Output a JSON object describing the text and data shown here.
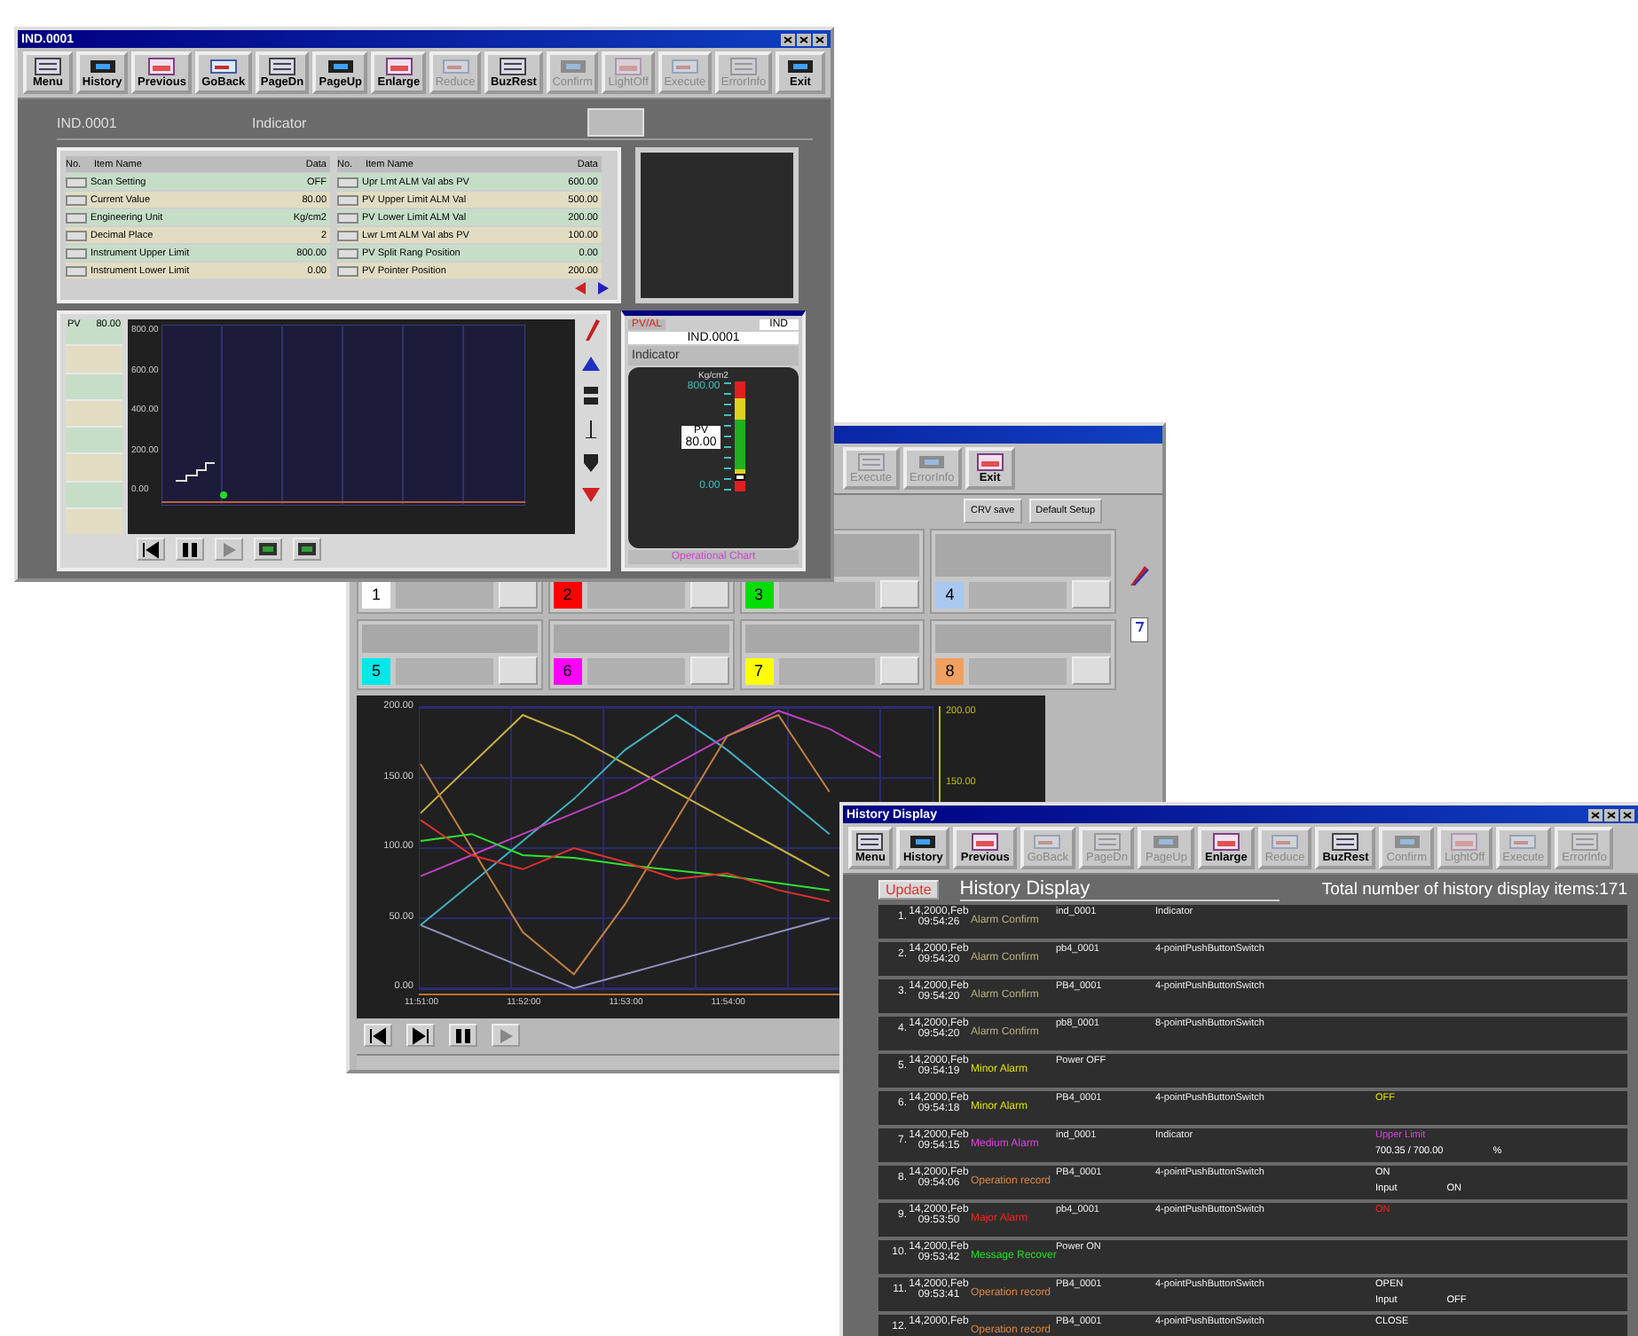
{
  "indicator_window": {
    "title": "IND.0001",
    "toolbar": [
      {
        "label": "Menu",
        "disabled": false
      },
      {
        "label": "History",
        "disabled": false
      },
      {
        "label": "Previous",
        "disabled": false
      },
      {
        "label": "GoBack",
        "disabled": false
      },
      {
        "label": "PageDn",
        "disabled": false
      },
      {
        "label": "PageUp",
        "disabled": false
      },
      {
        "label": "Enlarge",
        "disabled": false
      },
      {
        "label": "Reduce",
        "disabled": true
      },
      {
        "label": "BuzRest",
        "disabled": false
      },
      {
        "label": "Confirm",
        "disabled": true
      },
      {
        "label": "LightOff",
        "disabled": true
      },
      {
        "label": "Execute",
        "disabled": true
      },
      {
        "label": "ErrorInfo",
        "disabled": true
      },
      {
        "label": "Exit",
        "disabled": false
      }
    ],
    "tag": "IND.0001",
    "description": "Indicator",
    "columns_left": [
      "No.",
      "Item Name",
      "Data"
    ],
    "columns_right": [
      "No.",
      "Item Name",
      "Data"
    ],
    "items_left": [
      {
        "name": "Scan Setting",
        "data": "OFF"
      },
      {
        "name": "Current Value",
        "data": "80.00"
      },
      {
        "name": "Engineering Unit",
        "data": "Kg/cm2"
      },
      {
        "name": "Decimal Place",
        "data": "2"
      },
      {
        "name": "Instrument Upper Limit",
        "data": "800.00"
      },
      {
        "name": "Instrument Lower Limit",
        "data": "0.00"
      }
    ],
    "items_right": [
      {
        "name": "Upr Lmt ALM Val abs PV",
        "data": "600.00"
      },
      {
        "name": "PV Upper Limit ALM Val",
        "data": "500.00"
      },
      {
        "name": "PV Lower Limit ALM Val",
        "data": "200.00"
      },
      {
        "name": "Lwr Lmt ALM Val abs PV",
        "data": "100.00"
      },
      {
        "name": "PV Split Rang Position",
        "data": "0.00"
      },
      {
        "name": "PV Pointer Position",
        "data": "200.00"
      }
    ],
    "trend": {
      "pen_label": "PV",
      "pen_value": "80.00",
      "y_ticks": [
        "800.00",
        "600.00",
        "400.00",
        "200.00",
        "0.00"
      ]
    },
    "faceplate": {
      "alarm": "PV/AL",
      "type": "IND",
      "tag": "IND.0001",
      "description": "Indicator",
      "unit": "Kg/cm2",
      "high": "800.00",
      "pv_label": "PV",
      "pv": "80.00",
      "low": "0.00",
      "level": 0.1,
      "footer": "Operational Chart"
    }
  },
  "trend_window": {
    "toolbar": [
      {
        "label": "Execute",
        "disabled": true
      },
      {
        "label": "ErrorInfo",
        "disabled": true
      },
      {
        "label": "Exit",
        "disabled": false
      }
    ],
    "buttons": [
      "CRV save",
      "Default Setup"
    ],
    "pens": [
      {
        "number": "1",
        "color": "#ffffff"
      },
      {
        "number": "2",
        "color": "#ff0000"
      },
      {
        "number": "3",
        "color": "#00dd00"
      },
      {
        "number": "4",
        "color": "#a8c8f0"
      },
      {
        "number": "5",
        "color": "#00e8e8"
      },
      {
        "number": "6",
        "color": "#ff00ff"
      },
      {
        "number": "7",
        "color": "#ffff00"
      },
      {
        "number": "8",
        "color": "#f0a060"
      }
    ],
    "chart_data": {
      "type": "line",
      "grid": true,
      "categories": [
        "11:51:00",
        null,
        "11:52:00",
        null,
        "11:53:00",
        null,
        "11:54:00",
        null,
        null,
        null,
        null
      ],
      "ylim": [
        0,
        200
      ],
      "yticks": [
        {
          "value": 200,
          "label": "200.00"
        },
        {
          "value": 150,
          "label": "150.00"
        },
        {
          "value": 100,
          "label": "100.00"
        },
        {
          "value": 50,
          "label": "50.00"
        },
        {
          "value": 0,
          "label": "0.00"
        }
      ],
      "series": [
        {
          "color": "#c8b040",
          "values": [
            125,
            160,
            195,
            180,
            160,
            140,
            120,
            100,
            80,
            null,
            null
          ]
        },
        {
          "color": "#40b0c0",
          "values": [
            45,
            75,
            105,
            135,
            170,
            195,
            170,
            140,
            110,
            null,
            null
          ]
        },
        {
          "color": "#c040c0",
          "values": [
            80,
            95,
            110,
            125,
            140,
            160,
            180,
            198,
            185,
            165,
            null
          ]
        },
        {
          "color": "#c08040",
          "values": [
            160,
            100,
            40,
            10,
            60,
            120,
            180,
            195,
            140,
            null,
            null
          ]
        },
        {
          "color": "#9090c0",
          "values": [
            45,
            30,
            15,
            0,
            10,
            20,
            30,
            40,
            50,
            null,
            null
          ]
        },
        {
          "color": "#30e030",
          "values": [
            105,
            110,
            95,
            93,
            88,
            84,
            80,
            75,
            70,
            null,
            null
          ]
        },
        {
          "color": "#e03030",
          "values": [
            120,
            95,
            85,
            100,
            90,
            78,
            82,
            70,
            62,
            null,
            null
          ]
        }
      ]
    },
    "right_ticks": [
      "200.00",
      "150.00"
    ]
  },
  "history_window": {
    "title": "History Display",
    "toolbar": [
      {
        "label": "Menu",
        "disabled": false
      },
      {
        "label": "History",
        "disabled": false
      },
      {
        "label": "Previous",
        "disabled": false
      },
      {
        "label": "GoBack",
        "disabled": true
      },
      {
        "label": "PageDn",
        "disabled": true
      },
      {
        "label": "PageUp",
        "disabled": true
      },
      {
        "label": "Enlarge",
        "disabled": false
      },
      {
        "label": "Reduce",
        "disabled": true
      },
      {
        "label": "BuzRest",
        "disabled": false
      },
      {
        "label": "Confirm",
        "disabled": true
      },
      {
        "label": "LightOff",
        "disabled": true
      },
      {
        "label": "Execute",
        "disabled": true
      },
      {
        "label": "ErrorInfo",
        "disabled": true
      }
    ],
    "update": "Update",
    "heading": "History Display",
    "total": "Total number of history display items:171",
    "rows": [
      {
        "index": "1.",
        "date": "14,2000,Feb",
        "time": "09:54:26",
        "event": "Alarm Confirm",
        "color": "#b8b080",
        "tag": "ind_0001",
        "type": "Indicator",
        "lines": []
      },
      {
        "index": "2.",
        "date": "14,2000,Feb",
        "time": "09:54:20",
        "event": "Alarm Confirm",
        "color": "#b8b080",
        "tag": "pb4_0001",
        "type": "4-pointPushButtonSwitch",
        "lines": []
      },
      {
        "index": "3.",
        "date": "14,2000,Feb",
        "time": "09:54:20",
        "event": "Alarm Confirm",
        "color": "#b8b080",
        "tag": "PB4_0001",
        "type": "4-pointPushButtonSwitch",
        "lines": []
      },
      {
        "index": "4.",
        "date": "14,2000,Feb",
        "time": "09:54:20",
        "event": "Alarm Confirm",
        "color": "#b8b080",
        "tag": "pb8_0001",
        "type": "8-pointPushButtonSwitch",
        "lines": []
      },
      {
        "index": "5.",
        "date": "14,2000,Feb",
        "time": "09:54:19",
        "event": "Minor Alarm",
        "color": "#e0e000",
        "tag": "Power OFF",
        "type": "",
        "lines": []
      },
      {
        "index": "6.",
        "date": "14,2000,Feb",
        "time": "09:54:18",
        "event": "Minor Alarm",
        "color": "#e0e000",
        "tag": "PB4_0001",
        "type": "4-pointPushButtonSwitch",
        "lines": [
          {
            "color": "#e0e000",
            "parts": [
              "OFF"
            ]
          }
        ]
      },
      {
        "index": "7.",
        "date": "14,2000,Feb",
        "time": "09:54:15",
        "event": "Medium Alarm",
        "color": "#e040e0",
        "tag": "ind_0001",
        "type": "Indicator",
        "lines": [
          {
            "color": "#e040e0",
            "parts": [
              "Upper Limit"
            ]
          },
          {
            "color": "#ffffff",
            "parts": [
              "700.35  /  700.00",
              "%"
            ]
          }
        ]
      },
      {
        "index": "8.",
        "date": "14,2000,Feb",
        "time": "09:54:06",
        "event": "Operation record",
        "color": "#e08840",
        "tag": "PB4_0001",
        "type": "4-pointPushButtonSwitch",
        "lines": [
          {
            "color": "#ffffff",
            "parts": [
              "ON"
            ]
          },
          {
            "color": "#ffffff",
            "parts": [
              "Input",
              "ON"
            ]
          }
        ]
      },
      {
        "index": "9.",
        "date": "14,2000,Feb",
        "time": "09:53:50",
        "event": "Major Alarm",
        "color": "#ff2020",
        "tag": "pb4_0001",
        "type": "4-pointPushButtonSwitch",
        "lines": [
          {
            "color": "#ff2020",
            "parts": [
              "ON"
            ]
          }
        ]
      },
      {
        "index": "10.",
        "date": "14,2000,Feb",
        "time": "09:53:42",
        "event": "Message Recover",
        "color": "#20e020",
        "tag": "Power ON",
        "type": "",
        "lines": []
      },
      {
        "index": "11.",
        "date": "14,2000,Feb",
        "time": "09:53:41",
        "event": "Operation record",
        "color": "#e08840",
        "tag": "PB4_0001",
        "type": "4-pointPushButtonSwitch",
        "lines": [
          {
            "color": "#ffffff",
            "parts": [
              "OPEN"
            ]
          },
          {
            "color": "#ffffff",
            "parts": [
              "Input",
              "OFF"
            ]
          }
        ]
      },
      {
        "index": "12.",
        "date": "14,2000,Feb",
        "time": "",
        "event": "Operation record",
        "color": "#e08840",
        "tag": "PB4_0001",
        "type": "4-pointPushButtonSwitch",
        "lines": [
          {
            "color": "#ffffff",
            "parts": [
              "CLOSE"
            ]
          }
        ]
      }
    ]
  }
}
